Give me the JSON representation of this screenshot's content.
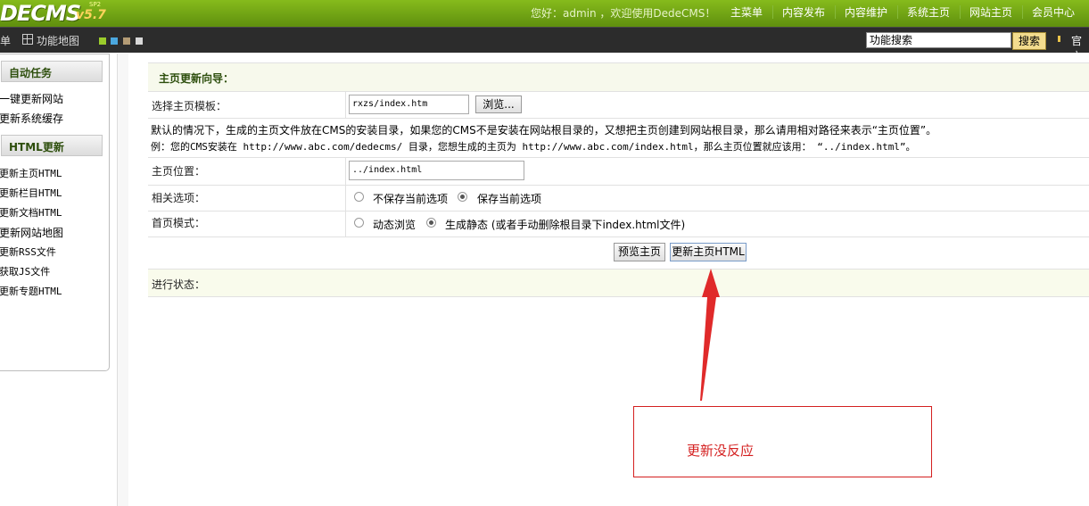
{
  "topbar": {
    "logo": "DECMS",
    "version": "v5.7",
    "version_sup": "SP2",
    "welcome": "您好：admin ，欢迎使用DedeCMS！",
    "nav": [
      "主菜单",
      "内容发布",
      "内容维护",
      "系统主页",
      "网站主页",
      "会员中心"
    ]
  },
  "secbar": {
    "menu_fragment": "单",
    "sitemap_label": "功能地图",
    "swatches": [
      "#9bcc2b",
      "#4ba7de",
      "#b39b75",
      "#d8d8d8"
    ],
    "search_value": "功能搜索",
    "search_button": "搜索",
    "official_label": "官方"
  },
  "sidebar": {
    "section1_title": "自动任务",
    "section1_items": [
      "一键更新网站",
      "更新系统缓存"
    ],
    "section2_title": "HTML更新",
    "section2_items": [
      "更新主页HTML",
      "更新栏目HTML",
      "更新文档HTML",
      "更新网站地图",
      "更新RSS文件",
      "获取JS文件",
      "更新专题HTML"
    ]
  },
  "main": {
    "title": "主页更新向导：",
    "template_label": "选择主页模板：",
    "template_value": "rxzs/index.htm",
    "browse_button": "浏览...",
    "note_line1": "默认的情况下，生成的主页文件放在CMS的安装目录，如果您的CMS不是安装在网站根目录的，又想把主页创建到网站根目录，那么请用相对路径来表示“主页位置”。",
    "note_line2": "例：您的CMS安装在 http://www.abc.com/dedecms/ 目录，您想生成的主页为 http://www.abc.com/index.html，那么主页位置就应该用： “../index.html”。",
    "position_label": "主页位置：",
    "position_value": "../index.html",
    "related_label": "相关选项：",
    "related_opt1": "不保存当前选项",
    "related_opt2": "保存当前选项",
    "mode_label": "首页模式：",
    "mode_opt1": "动态浏览",
    "mode_opt2": "生成静态 (或者手动删除根目录下index.html文件)",
    "preview_button": "预览主页",
    "update_button": "更新主页HTML",
    "status_label": "进行状态："
  },
  "annotation": {
    "text": "更新没反应",
    "color": "#d42020"
  }
}
